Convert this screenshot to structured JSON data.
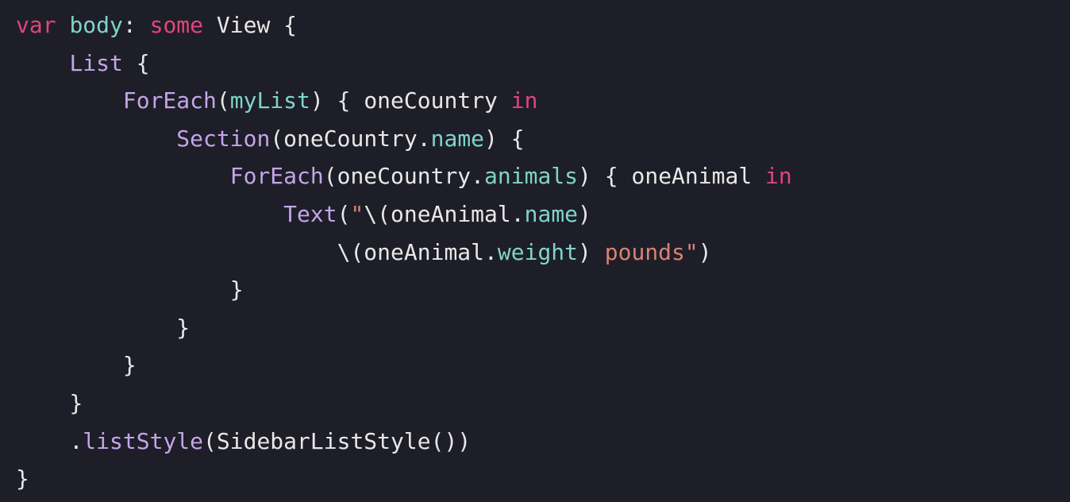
{
  "code": {
    "line1": {
      "keyword1": "var",
      "property": "body",
      "colon": ": ",
      "keyword2": "some",
      "type": "View",
      "brace": " {"
    },
    "line2": {
      "indent": "    ",
      "type": "List",
      "brace": " {"
    },
    "line3": {
      "indent": "        ",
      "type": "ForEach",
      "paren1": "(",
      "param": "myList",
      "paren2": ")",
      "brace": " { ",
      "identifier": "oneCountry",
      "keyword": " in"
    },
    "line4": {
      "indent": "            ",
      "type": "Section",
      "paren1": "(",
      "identifier": "oneCountry",
      "dot": ".",
      "property": "name",
      "paren2": ")",
      "brace": " {"
    },
    "line5": {
      "indent": "                ",
      "type": "ForEach",
      "paren1": "(",
      "identifier": "oneCountry",
      "dot": ".",
      "property": "animals",
      "paren2": ")",
      "brace": " { ",
      "identifier2": "oneAnimal",
      "keyword": " in"
    },
    "line6": {
      "indent": "                    ",
      "type": "Text",
      "paren1": "(",
      "string1": "\"",
      "interp1": "\\(",
      "identifier": "oneAnimal",
      "dot": ".",
      "property": "name",
      "interp2": ")"
    },
    "line7": {
      "indent": "                        ",
      "interp1": "\\(",
      "identifier": "oneAnimal",
      "dot": ".",
      "property": "weight",
      "interp2": ")",
      "string": " pounds\"",
      "paren": ")"
    },
    "line8": {
      "indent": "                ",
      "brace": "}"
    },
    "line9": {
      "indent": "            ",
      "brace": "}"
    },
    "line10": {
      "indent": "        ",
      "brace": "}"
    },
    "line11": {
      "indent": "    ",
      "brace": "}"
    },
    "line12": {
      "indent": "    ",
      "dot": ".",
      "method": "listStyle",
      "paren1": "(",
      "type": "SidebarListStyle",
      "parens": "()",
      "paren2": ")"
    },
    "line13": {
      "brace": "}"
    }
  }
}
